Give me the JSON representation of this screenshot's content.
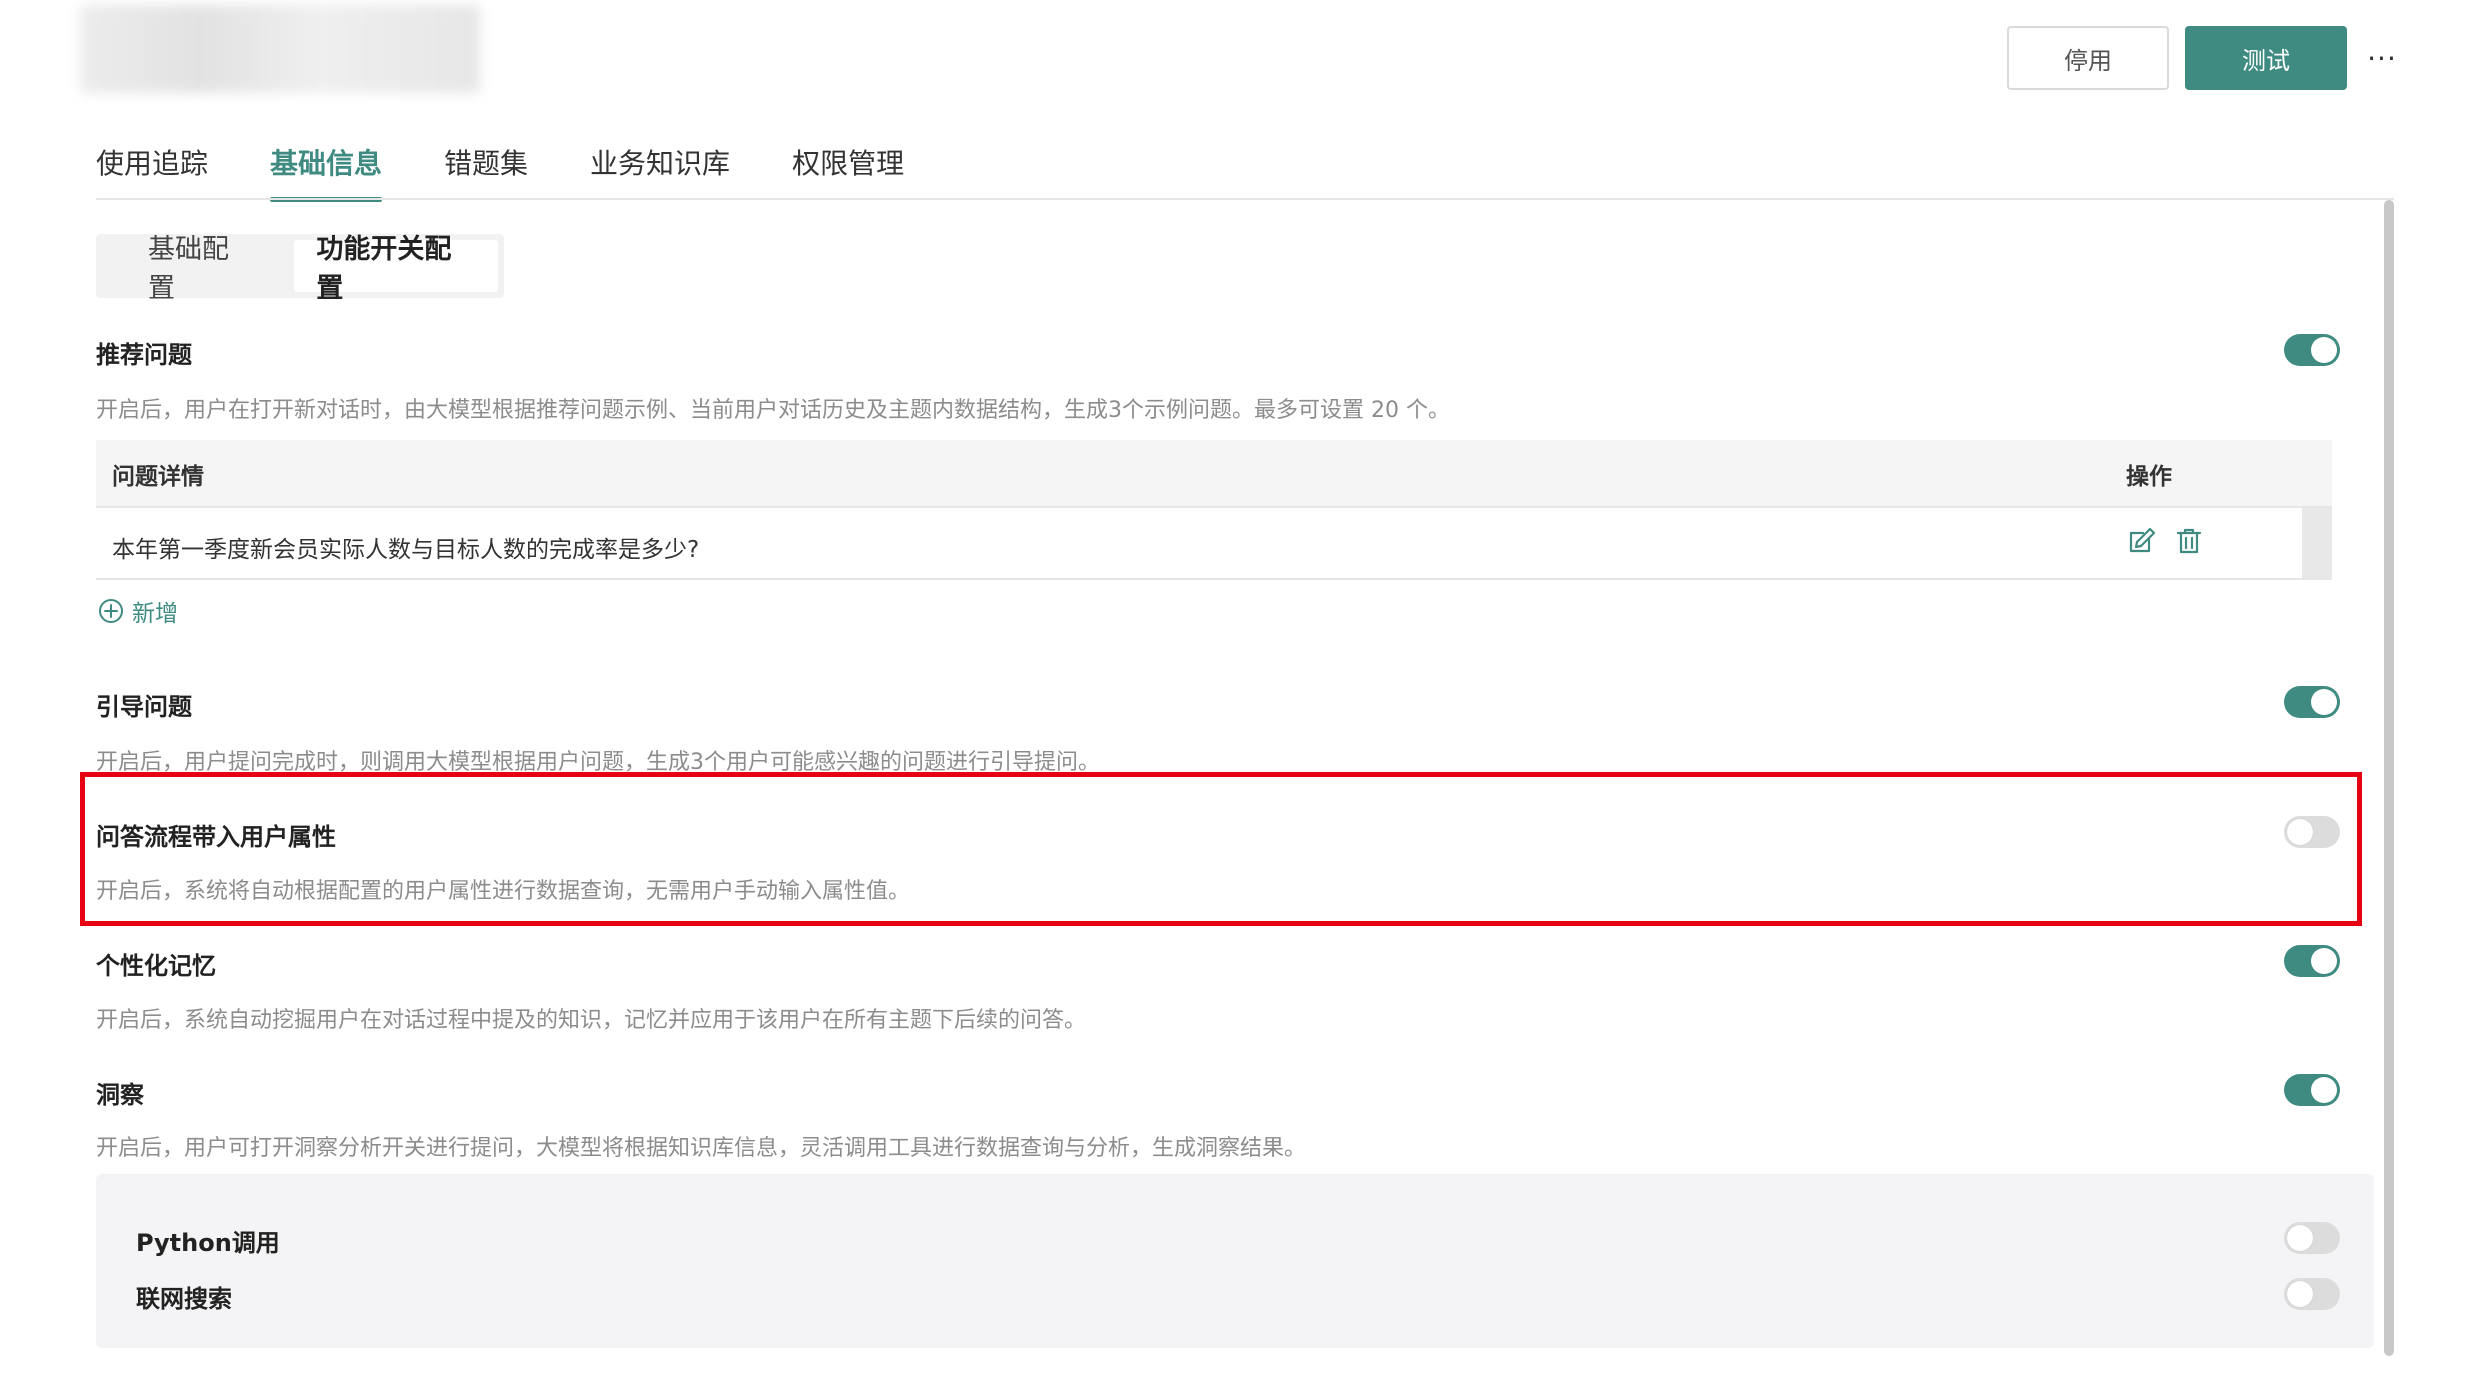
{
  "header": {
    "disable_label": "停用",
    "test_label": "测试",
    "more_label": "···"
  },
  "tabs": [
    {
      "label": "使用追踪"
    },
    {
      "label": "基础信息"
    },
    {
      "label": "错题集"
    },
    {
      "label": "业务知识库"
    },
    {
      "label": "权限管理"
    }
  ],
  "subtabs": [
    {
      "label": "基础配置"
    },
    {
      "label": "功能开关配置"
    }
  ],
  "recommend": {
    "title": "推荐问题",
    "desc": "开启后，用户在打开新对话时，由大模型根据推荐问题示例、当前用户对话历史及主题内数据结构，生成3个示例问题。最多可设置 20 个。",
    "enabled": true,
    "table": {
      "col_question": "问题详情",
      "col_action": "操作",
      "rows": [
        {
          "question": "本年第一季度新会员实际人数与目标人数的完成率是多少?"
        }
      ]
    },
    "add_label": "新增"
  },
  "guide": {
    "title": "引导问题",
    "desc": "开启后，用户提问完成时，则调用大模型根据用户问题，生成3个用户可能感兴趣的问题进行引导提问。",
    "enabled": true
  },
  "user_attr": {
    "title": "问答流程带入用户属性",
    "desc": "开启后，系统将自动根据配置的用户属性进行数据查询，无需用户手动输入属性值。",
    "enabled": false
  },
  "memory": {
    "title": "个性化记忆",
    "desc": "开启后，系统自动挖掘用户在对话过程中提及的知识，记忆并应用于该用户在所有主题下后续的问答。",
    "enabled": true
  },
  "insight": {
    "title": "洞察",
    "desc": "开启后，用户可打开洞察分析开关进行提问，大模型将根据知识库信息，灵活调用工具进行数据查询与分析，生成洞察结果。",
    "enabled": true,
    "sub": [
      {
        "label": "Python调用",
        "enabled": false
      },
      {
        "label": "联网搜索",
        "enabled": false
      }
    ]
  },
  "colors": {
    "accent": "#3f8b82",
    "highlight": "#e60012",
    "toggle_off": "#dcdcdc"
  }
}
